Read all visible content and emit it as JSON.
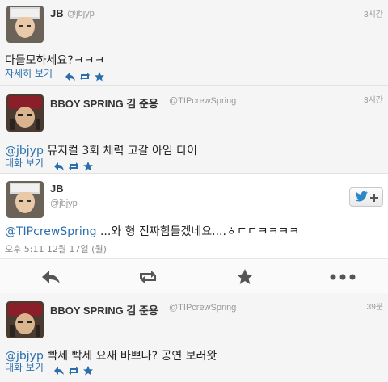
{
  "tweets": [
    {
      "name": "JB",
      "handle": "@jbjyp",
      "time": "3시간",
      "text": "다들모하세요?ㅋㅋㅋ",
      "link": "자세히 보기"
    },
    {
      "name": "BBOY SPRING 김 준용",
      "handle": "@TIPcrewSpring",
      "time": "3시간",
      "mention": "@jbjyp",
      "text": " 뮤지컬 3회 체력 고갈 아임 다이",
      "link": "대화 보기"
    },
    {
      "name": "JB",
      "handle": "@jbjyp",
      "mention": "@TIPcrewSpring",
      "text": " ...와 형 진짜힘들겠네요....ㅎㄷㄷㅋㅋㅋㅋ",
      "date": "오후 5:11 12월 17일 (월)"
    },
    {
      "name": "BBOY SPRING 김 준용",
      "handle": "@TIPcrewSpring",
      "time": "39분",
      "mention": "@jbjyp",
      "text": " 빡세 빡세 요새 바쁘나? 공연 보러왓",
      "link": "대화 보기"
    }
  ],
  "colors": {
    "link": "#2a6ead",
    "action_icon": "#555555",
    "twitter_blue": "#2a88c9"
  },
  "icons": {
    "mini": [
      "reply-icon",
      "retweet-icon",
      "favorite-star-icon"
    ],
    "big": [
      "reply-icon",
      "retweet-icon",
      "favorite-star-icon",
      "more-icon"
    ],
    "follow": [
      "twitter-bird-icon",
      "plus-icon"
    ]
  }
}
